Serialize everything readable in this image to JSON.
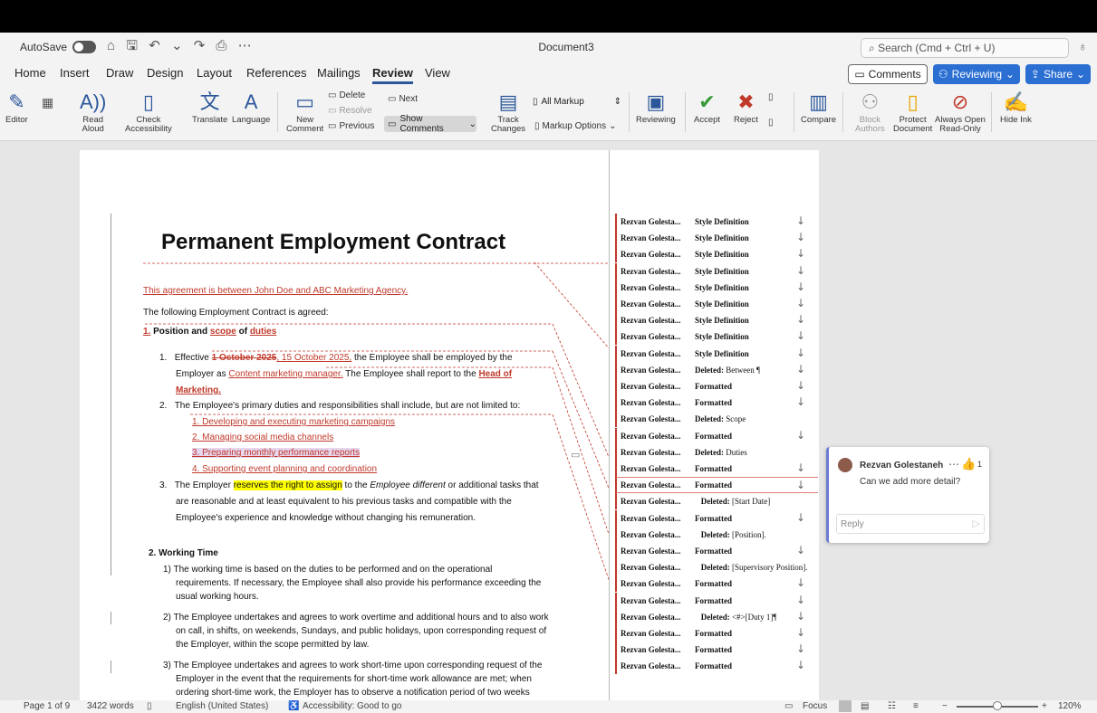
{
  "titlebar": {
    "autosave_label": "AutoSave",
    "doc_title": "Document3",
    "search_placeholder": "Search (Cmd + Ctrl + U)"
  },
  "tabs": [
    "Home",
    "Insert",
    "Draw",
    "Design",
    "Layout",
    "References",
    "Mailings",
    "Review",
    "View"
  ],
  "active_tab": "Review",
  "header_buttons": {
    "comments": "Comments",
    "reviewing": "Reviewing",
    "share": "Share"
  },
  "ribbon": {
    "editor": "Editor",
    "read_aloud": [
      "Read",
      "Aloud"
    ],
    "check_accessibility": [
      "Check",
      "Accessibility"
    ],
    "translate": "Translate",
    "language": "Language",
    "new_comment": [
      "New",
      "Comment"
    ],
    "delete": "Delete",
    "resolve": "Resolve",
    "previous": "Previous",
    "next": "Next",
    "show_comments": "Show Comments",
    "track_changes": [
      "Track",
      "Changes"
    ],
    "all_markup": "All Markup",
    "markup_options": "Markup Options",
    "reviewing": "Reviewing",
    "accept": "Accept",
    "reject": "Reject",
    "compare": "Compare",
    "block_authors": [
      "Block",
      "Authors"
    ],
    "protect_document": [
      "Protect",
      "Document"
    ],
    "always_open_read_only": [
      "Always Open",
      "Read-Only"
    ],
    "hide_ink": "Hide Ink"
  },
  "document": {
    "title": "Permanent Employment Contract",
    "intro_inserted": "This agreement is between John Doe and ABC Marketing Agency.",
    "intro": "The following Employment Contract is agreed:",
    "h1": {
      "num": "1.",
      "a": "Position and ",
      "b": "scope",
      "c": " of ",
      "d": "duties"
    },
    "item1": {
      "num": "1.",
      "a": "Effective ",
      "deleted": "1 October 2025",
      "inserted": ", 15 October 2025,",
      "b": " the Employee shall be employed by the",
      "c": "Employer as ",
      "role": "Content marketing manager.",
      "d": " The Employee shall report to the ",
      "head": "Head of",
      "head2": "Marketing."
    },
    "item2": "The Employee's primary duties and responsibilities shall include, but are not limited to:",
    "duties": [
      "1.   Developing and executing marketing campaigns",
      "2.   Managing social media channels",
      "3.   Preparing monthly performance reports",
      "4.   Supporting event planning and coordination"
    ],
    "item3": {
      "num": "3.",
      "a": "The Employer ",
      "hl": "reserves the right to assign",
      "b": " to the ",
      "it": "Employee different",
      "c": " or additional tasks that",
      "line2": "are reasonable and at least equivalent to his previous tasks and compatible with the",
      "line3": "Employee's experience and knowledge without changing his remuneration."
    },
    "h2": "2. Working Time",
    "wt1": [
      "1) The working time is based on the duties to be performed and on the operational",
      "requirements. If necessary, the Employee shall also provide his performance exceeding the",
      "usual working hours."
    ],
    "wt2": [
      "2) The Employee undertakes and agrees to work overtime and additional hours and to also work",
      "on call, in shifts, on weekends, Sundays, and public holidays, upon corresponding request of",
      "the Employer, within the scope permitted by law."
    ],
    "wt3": [
      "3) The Employee undertakes and agrees to work short-time upon corresponding request of the",
      "Employer in the event that the requirements for short-time work allowance are met; when",
      "ordering short-time work, the Employer has to observe a notification period of two weeks"
    ]
  },
  "balloons": [
    {
      "author": "Rezvan Golesta...",
      "action": "Style Definition",
      "detail": "",
      "arrow": true
    },
    {
      "author": "Rezvan Golesta...",
      "action": "Style Definition",
      "detail": "",
      "arrow": true
    },
    {
      "author": "Rezvan Golesta...",
      "action": "Style Definition",
      "detail": "",
      "arrow": true
    },
    {
      "author": "Rezvan Golesta...",
      "action": "Style Definition",
      "detail": "",
      "arrow": true
    },
    {
      "author": "Rezvan Golesta...",
      "action": "Style Definition",
      "detail": "",
      "arrow": true
    },
    {
      "author": "Rezvan Golesta...",
      "action": "Style Definition",
      "detail": "",
      "arrow": true
    },
    {
      "author": "Rezvan Golesta...",
      "action": "Style Definition",
      "detail": "",
      "arrow": true
    },
    {
      "author": "Rezvan Golesta...",
      "action": "Style Definition",
      "detail": "",
      "arrow": true
    },
    {
      "author": "Rezvan Golesta...",
      "action": "Style Definition",
      "detail": "",
      "arrow": true
    },
    {
      "author": "Rezvan Golesta...",
      "action": "Deleted:",
      "detail": " Between ¶",
      "arrow": true
    },
    {
      "author": "Rezvan Golesta...",
      "action": "Formatted",
      "detail": "",
      "arrow": true
    },
    {
      "author": "Rezvan Golesta...",
      "action": "Formatted",
      "detail": "",
      "arrow": true
    },
    {
      "author": "Rezvan Golesta...",
      "action": "Deleted:",
      "detail": " Scope",
      "arrow": false
    },
    {
      "author": "Rezvan Golesta...",
      "action": "Formatted",
      "detail": "",
      "arrow": true
    },
    {
      "author": "Rezvan Golesta...",
      "action": "Deleted:",
      "detail": " Duties",
      "arrow": false
    },
    {
      "author": "Rezvan Golesta...",
      "action": "Formatted",
      "detail": "",
      "arrow": true
    },
    {
      "author": "Rezvan Golesta...",
      "action": "Formatted",
      "detail": "",
      "arrow": true
    },
    {
      "author": "Rezvan Golesta...",
      "action": "   Deleted:",
      "detail": " [Start Date]",
      "arrow": false
    },
    {
      "author": "Rezvan Golesta...",
      "action": "Formatted",
      "detail": "",
      "arrow": true
    },
    {
      "author": "Rezvan Golesta...",
      "action": "   Deleted:",
      "detail": " [Position].",
      "arrow": false
    },
    {
      "author": "Rezvan Golesta...",
      "action": "Formatted",
      "detail": "",
      "arrow": true
    },
    {
      "author": "Rezvan Golesta...",
      "action": "   Deleted:",
      "detail": " [Supervisory Position].",
      "arrow": false
    },
    {
      "author": "Rezvan Golesta...",
      "action": "Formatted",
      "detail": "",
      "arrow": true
    },
    {
      "author": "Rezvan Golesta...",
      "action": "Formatted",
      "detail": "",
      "arrow": true
    },
    {
      "author": "Rezvan Golesta...",
      "action": "   Deleted:",
      "detail": " <#>[Duty 1]¶",
      "arrow": true
    },
    {
      "author": "Rezvan Golesta...",
      "action": "Formatted",
      "detail": "",
      "arrow": true
    },
    {
      "author": "Rezvan Golesta...",
      "action": "Formatted",
      "detail": "",
      "arrow": true
    },
    {
      "author": "Rezvan Golesta...",
      "action": "Formatted",
      "detail": "",
      "arrow": true
    }
  ],
  "comment": {
    "author": "Rezvan Golestaneh",
    "like_count": "1",
    "text": "Can we add more detail?",
    "reply_placeholder": "Reply"
  },
  "statusbar": {
    "page": "Page 1 of 9",
    "words": "3422 words",
    "language": "English (United States)",
    "accessibility": "Accessibility: Good to go",
    "focus": "Focus",
    "zoom": "120%",
    "zoom_fraction": 0.5
  }
}
